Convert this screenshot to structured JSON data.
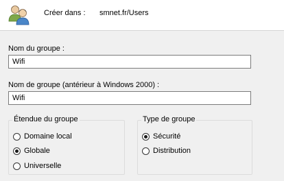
{
  "header": {
    "create_in_label": "Créer dans :",
    "create_in_value": "smnet.fr/Users",
    "icon": "users-group-icon"
  },
  "form": {
    "group_name": {
      "label": "Nom du groupe :",
      "value": "Wifi"
    },
    "group_name_pre2000": {
      "label": "Nom de groupe (antérieur à Windows 2000) :",
      "value": "Wifi"
    }
  },
  "scope": {
    "title": "Étendue du groupe",
    "options": [
      {
        "label": "Domaine local",
        "checked": false
      },
      {
        "label": "Globale",
        "checked": true
      },
      {
        "label": "Universelle",
        "checked": false
      }
    ]
  },
  "type": {
    "title": "Type de groupe",
    "options": [
      {
        "label": "Sécurité",
        "checked": true
      },
      {
        "label": "Distribution",
        "checked": false
      }
    ]
  }
}
